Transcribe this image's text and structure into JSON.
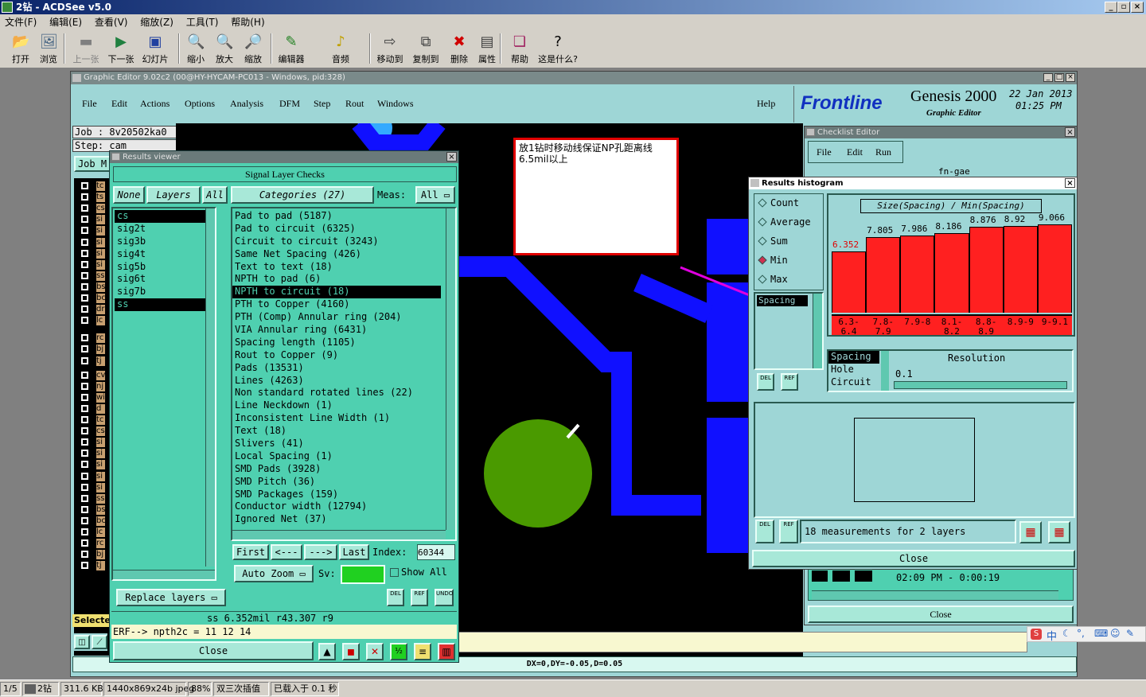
{
  "acdsee": {
    "title": "2钻 - ACDSee v5.0",
    "menu": [
      "文件(F)",
      "编辑(E)",
      "查看(V)",
      "缩放(Z)",
      "工具(T)",
      "帮助(H)"
    ],
    "toolbar": [
      {
        "label": "打开",
        "icon": "folder-open-icon",
        "enabled": true
      },
      {
        "label": "浏览",
        "icon": "browse-icon",
        "enabled": true
      },
      {
        "label": "上一张",
        "icon": "previous-icon",
        "enabled": false
      },
      {
        "label": "下一张",
        "icon": "next-icon",
        "enabled": true
      },
      {
        "label": "幻灯片",
        "icon": "slideshow-icon",
        "enabled": true
      },
      {
        "label": "缩小",
        "icon": "zoom-out-icon",
        "enabled": true
      },
      {
        "label": "放大",
        "icon": "zoom-in-icon",
        "enabled": true
      },
      {
        "label": "缩放",
        "icon": "zoom-icon",
        "enabled": true
      },
      {
        "label": "编辑器",
        "icon": "editor-icon",
        "enabled": true
      },
      {
        "label": "音频",
        "icon": "audio-icon",
        "enabled": true
      },
      {
        "label": "移动到",
        "icon": "move-to-icon",
        "enabled": true
      },
      {
        "label": "复制到",
        "icon": "copy-to-icon",
        "enabled": true
      },
      {
        "label": "删除",
        "icon": "delete-icon",
        "enabled": true
      },
      {
        "label": "属性",
        "icon": "properties-icon",
        "enabled": true
      },
      {
        "label": "帮助",
        "icon": "help-book-icon",
        "enabled": true
      },
      {
        "label": "这是什么?",
        "icon": "whats-this-icon",
        "enabled": true
      }
    ],
    "status": [
      "1/5",
      "2钻",
      "311.6 KB",
      "1440x869x24b jpeg",
      "88%",
      "双三次插值",
      "已载入于 0.1 秒"
    ]
  },
  "genesis": {
    "title": "Graphic Editor 9.02c2 (00@HY-HYCAM-PC013 - Windows, pid:328)",
    "menu": [
      "File",
      "Edit",
      "Actions",
      "Options",
      "Analysis",
      "DFM",
      "Step",
      "Rout",
      "Windows"
    ],
    "help": "Help",
    "logo": {
      "brand": "Frontline",
      "product": "Genesis 2000",
      "subtitle": "Graphic Editor",
      "date": "22 Jan 2013",
      "time": "01:25 PM"
    },
    "job": {
      "job_line": "Job : 8v20502ka0",
      "step_line": "Step: cam",
      "job_btn": "Job M",
      "selected_label": "Selecte"
    },
    "layer_tags": [
      "tc",
      "ts",
      "cs",
      "si",
      "si",
      "si",
      "si",
      "si",
      "ss",
      "bs",
      "bc",
      "dr",
      "lc",
      "rc",
      "bj",
      "tj",
      "cv",
      "nj",
      "wi",
      "d",
      "tc",
      "cs",
      "si",
      "si",
      "si",
      "si",
      "si",
      "ss",
      "bs",
      "bc",
      "lc",
      "rc",
      "bj",
      "tj"
    ],
    "cmd_line": "ERF--> npth2c = 11 12 14",
    "coords": "DX=0,DY=-0.05,D=0.05"
  },
  "note": {
    "text": "放1钻时移动线保证NP孔距离线6.5mil以上"
  },
  "results_viewer": {
    "title": "Results viewer",
    "header": "Signal Layer Checks",
    "btn_none": "None",
    "btn_layers": "Layers",
    "btn_all": "All",
    "categories_label": "Categories (27)",
    "meas_label": "Meas:",
    "meas_value": "All",
    "layers": [
      "cs",
      "sig2t",
      "sig3b",
      "sig4t",
      "sig5b",
      "sig6t",
      "sig7b",
      "ss"
    ],
    "selected_layers": [
      "cs",
      "ss"
    ],
    "categories": [
      "Pad to pad (5187)",
      "Pad to circuit (6325)",
      "Circuit to circuit (3243)",
      "Same Net Spacing (426)",
      "Text to text (18)",
      "NPTH to pad (6)",
      "NPTH to circuit (18)",
      "PTH to Copper (4160)",
      "PTH (Comp) Annular ring (204)",
      "VIA Annular ring (6431)",
      "Spacing length (1105)",
      "Rout to Copper (9)",
      "Pads (13531)",
      "Lines (4263)",
      "Non standard rotated lines (22)",
      "Line Neckdown (1)",
      "Inconsistent Line Width (1)",
      "Text (18)",
      "Slivers (41)",
      "Local Spacing (1)",
      "SMD Pads (3928)",
      "SMD Pitch (36)",
      "SMD Packages (159)",
      "Conductor width (12794)",
      "Ignored Net (37)"
    ],
    "selected_category": "NPTH to circuit (18)",
    "nav": {
      "first": "First",
      "prev": "<---",
      "next": "--->",
      "last": "Last",
      "index_label": "Index:",
      "index_value": "60344"
    },
    "auto_zoom": "Auto Zoom",
    "sv_label": "Sv:",
    "show_all": "Show All",
    "replace_layers": "Replace layers",
    "mini_btns": [
      "DEL",
      "REF",
      "UNDO"
    ],
    "result_line": "ss 6.352mil   r43.307   r9",
    "close": "Close"
  },
  "checklist": {
    "title": "Checklist Editor",
    "menu": [
      "File",
      "Edit",
      "Run"
    ],
    "name": "fn-gae",
    "time_line": "02:09 PM - 0:00:19",
    "close": "Close"
  },
  "histogram": {
    "title": "Results histogram",
    "modes": [
      "Count",
      "Average",
      "Sum",
      "Min",
      "Max"
    ],
    "selected_mode": "Min",
    "header": "Size(Spacing) / Min(Spacing)",
    "list_item": "Spacing",
    "mini_btns": [
      "DEL",
      "REF"
    ],
    "res_list": [
      "Spacing",
      "Hole",
      "Circuit"
    ],
    "resolution_label": "Resolution",
    "resolution_value": "0.1",
    "summary": "18 measurements for 2 layers",
    "close": "Close"
  },
  "chart_data": {
    "type": "bar",
    "title": "Size(Spacing) / Min(Spacing)",
    "categories": [
      "6.3-6.4",
      "7.8-7.9",
      "7.9-8",
      "8.1-8.2",
      "8.8-8.9",
      "8.9-9",
      "9-9.1"
    ],
    "values": [
      6.352,
      7.805,
      7.986,
      8.186,
      8.876,
      8.92,
      9.066
    ],
    "labels": [
      "6.352",
      "7.805",
      "7.986",
      "8.186",
      "8.876",
      "8.92",
      "9.066"
    ],
    "bar_color": "#ff2020",
    "ylim": [
      0,
      10
    ]
  },
  "colors": {
    "panel": "#4fd0b0",
    "editor_bg": "#9ed6d6",
    "copper": "#1010ff",
    "hole": "#4a9a00",
    "accent": "#e000e0"
  }
}
